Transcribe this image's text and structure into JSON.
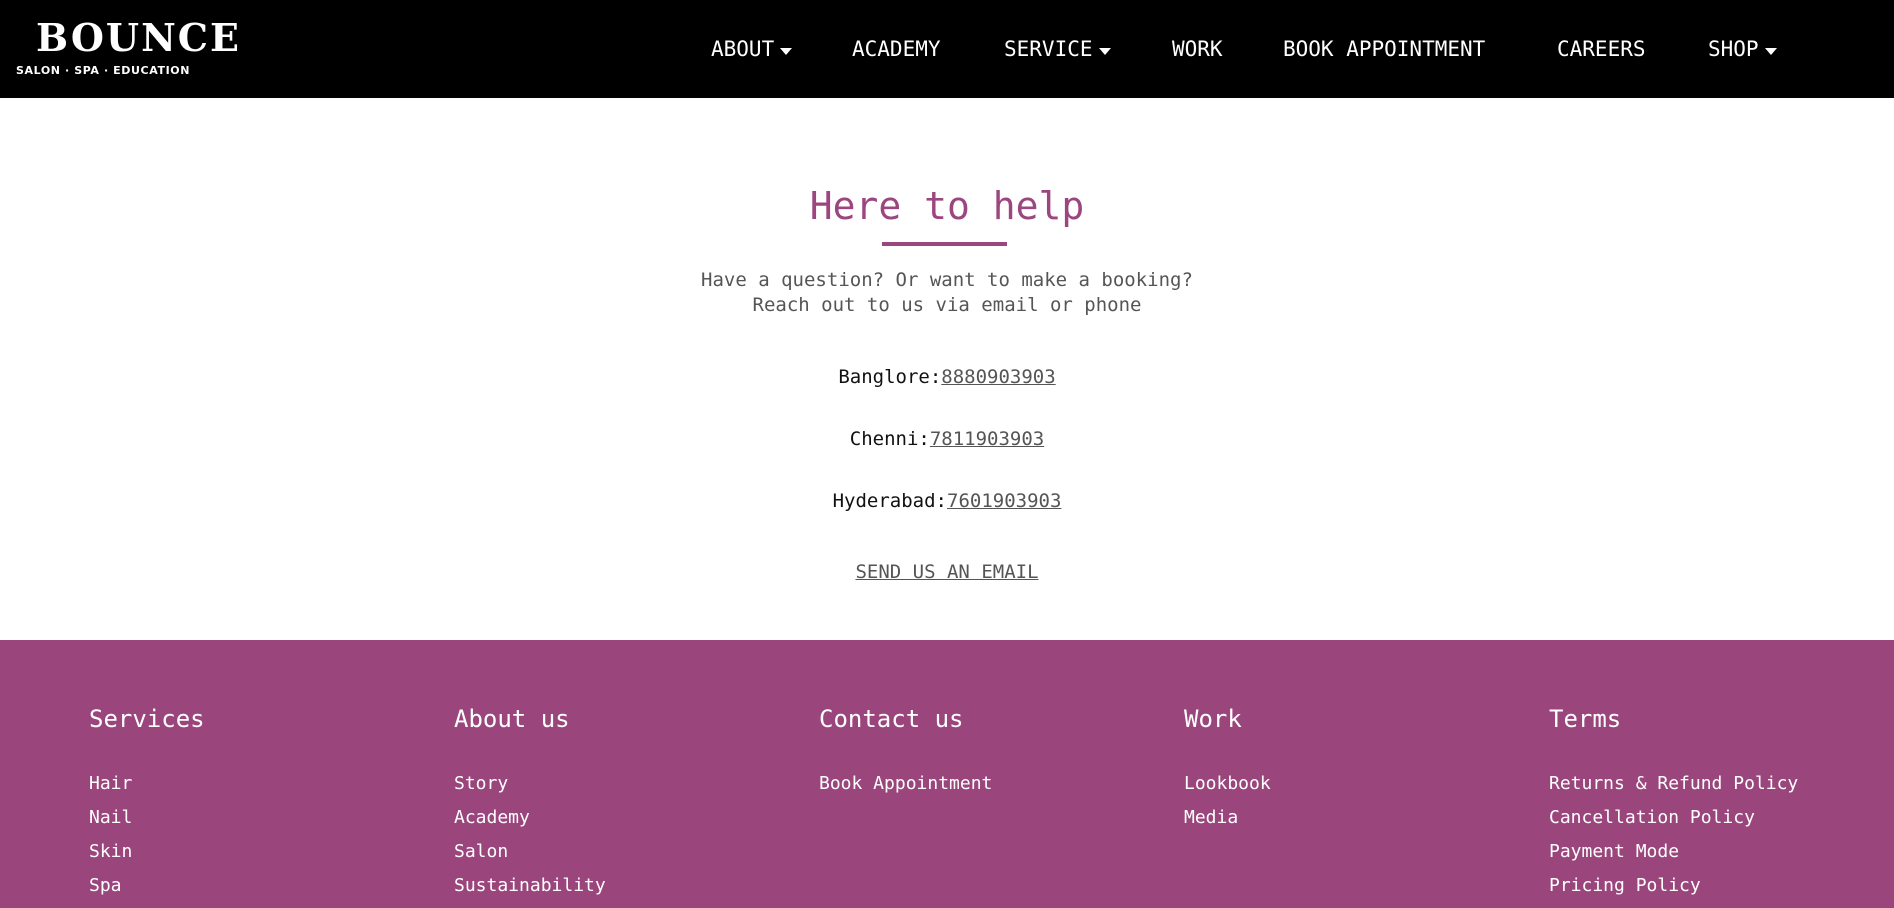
{
  "header": {
    "logo": {
      "word": "BOUNCE",
      "tagline": "SALON · SPA · EDUCATION"
    },
    "nav": [
      {
        "label": "ABOUT",
        "dropdown": true
      },
      {
        "label": "ACADEMY",
        "dropdown": false
      },
      {
        "label": "SERVICE",
        "dropdown": true
      },
      {
        "label": "WORK",
        "dropdown": false
      },
      {
        "label": "BOOK APPOINTMENT",
        "dropdown": false
      },
      {
        "label": "CAREERS",
        "dropdown": false
      },
      {
        "label": "SHOP",
        "dropdown": true
      }
    ]
  },
  "main": {
    "title": "Here to help",
    "intro": [
      "Have a question? Or want to make a booking?",
      "Reach out to us via email or phone"
    ],
    "contacts": [
      {
        "city": "Banglore:",
        "phone": "8880903903"
      },
      {
        "city": "Chenni:",
        "phone": "7811903903"
      },
      {
        "city": "Hyderabad:",
        "phone": "7601903903"
      }
    ],
    "email_link": "SEND US AN EMAIL"
  },
  "footer": {
    "columns": [
      {
        "heading": "Services",
        "links": [
          "Hair",
          "Nail",
          "Skin",
          "Spa"
        ]
      },
      {
        "heading": "About us",
        "links": [
          "Story",
          "Academy",
          "Salon",
          "Sustainability"
        ]
      },
      {
        "heading": "Contact us",
        "links": [
          "Book Appointment"
        ]
      },
      {
        "heading": "Work",
        "links": [
          "Lookbook",
          "Media"
        ]
      },
      {
        "heading": "Terms",
        "links": [
          "Returns & Refund Policy",
          "Cancellation Policy",
          "Payment Mode",
          "Pricing Policy"
        ]
      }
    ]
  },
  "colors": {
    "header_bg": "#000000",
    "accent": "#9c4680",
    "footer_bg": "#9a467d",
    "text_muted": "#555555"
  }
}
